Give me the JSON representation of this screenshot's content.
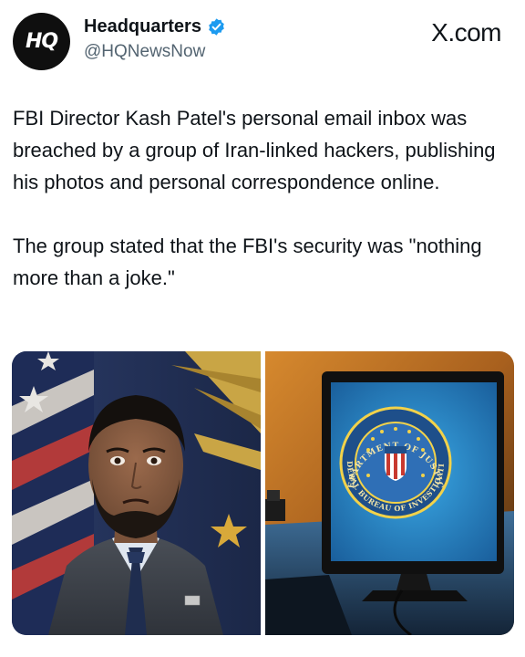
{
  "author": {
    "avatar_text": "HQ",
    "display_name": "Headquarters",
    "handle": "@HQNewsNow",
    "verified_icon": "verified-badge-icon",
    "verified_color": "#1d9bf0"
  },
  "site_label": "X.com",
  "tweet": {
    "paragraphs": [
      "FBI Director Kash Patel's personal email inbox was breached by a group of Iran-linked hackers, publishing his photos and personal correspondence online.",
      "The group stated that the FBI's security was \"nothing more than a joke.\""
    ]
  },
  "media": {
    "seal_top_text": "DEPARTMENT OF JUSTICE",
    "seal_bottom_text": "FEDERAL BUREAU OF INVESTIGATION"
  },
  "colors": {
    "text_primary": "#0f1419",
    "text_secondary": "#536471",
    "accent": "#1d9bf0"
  }
}
